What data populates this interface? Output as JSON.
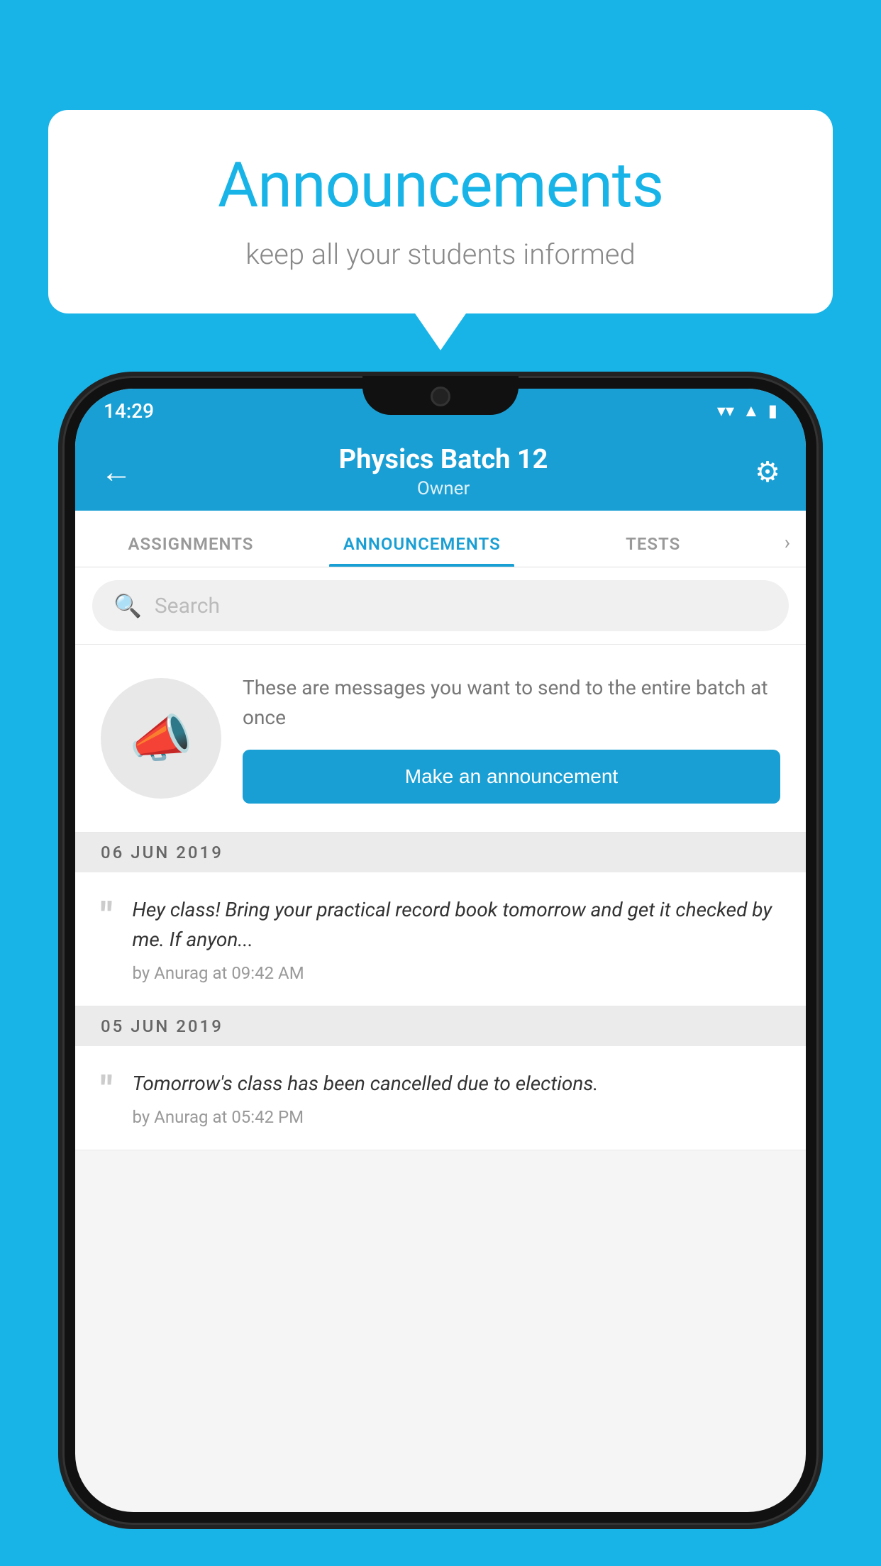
{
  "bubble": {
    "title": "Announcements",
    "subtitle": "keep all your students informed"
  },
  "phone": {
    "statusBar": {
      "time": "14:29"
    },
    "header": {
      "title": "Physics Batch 12",
      "subtitle": "Owner",
      "backLabel": "←",
      "gearLabel": "⚙"
    },
    "tabs": [
      {
        "label": "ASSIGNMENTS",
        "active": false
      },
      {
        "label": "ANNOUNCEMENTS",
        "active": true
      },
      {
        "label": "TESTS",
        "active": false
      }
    ],
    "search": {
      "placeholder": "Search"
    },
    "promo": {
      "description": "These are messages you want to send to the entire batch at once",
      "buttonLabel": "Make an announcement"
    },
    "announcements": [
      {
        "date": "06  JUN  2019",
        "text": "Hey class! Bring your practical record book tomorrow and get it checked by me. If anyon...",
        "meta": "by Anurag at 09:42 AM"
      },
      {
        "date": "05  JUN  2019",
        "text": "Tomorrow's class has been cancelled due to elections.",
        "meta": "by Anurag at 05:42 PM"
      }
    ]
  },
  "colors": {
    "primary": "#18b4e8",
    "appBar": "#1a9fd4"
  }
}
